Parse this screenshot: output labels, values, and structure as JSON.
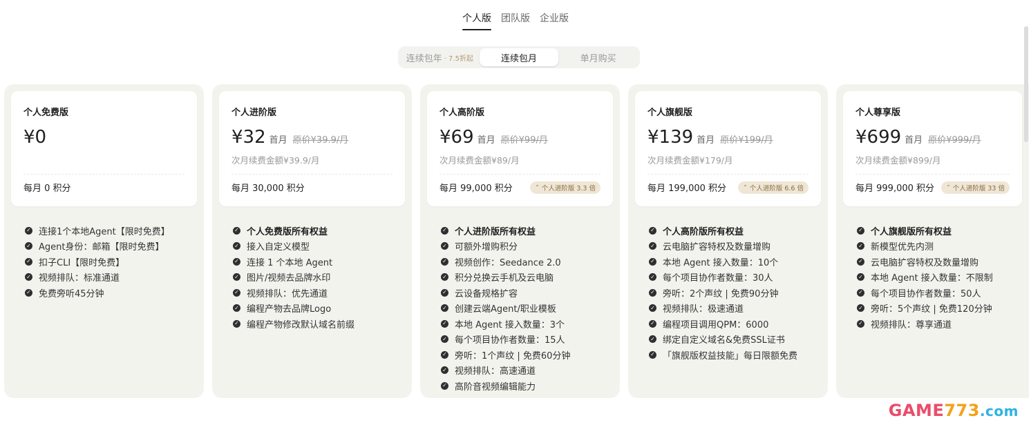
{
  "tabs": [
    "个人版",
    "团队版",
    "企业版"
  ],
  "billing": {
    "annual_label": "连续包年",
    "annual_sub": "· 7.5折起",
    "monthly_label": "连续包月",
    "single_label": "单月购买"
  },
  "plans": [
    {
      "name": "个人免费版",
      "price": "¥0",
      "first_label": "",
      "original": "",
      "renew": "",
      "credits": "每月 0 积分",
      "badge": "",
      "features": [
        {
          "text": "连接1个本地Agent【限时免费】",
          "bold": false
        },
        {
          "text": "Agent身份：邮箱【限时免费】",
          "bold": false
        },
        {
          "text": "扣子CLI【限时免费】",
          "bold": false
        },
        {
          "text": "视频排队：标准通道",
          "bold": false
        },
        {
          "text": "免费旁听45分钟",
          "bold": false
        }
      ]
    },
    {
      "name": "个人进阶版",
      "price": "¥32",
      "first_label": "首月",
      "original": "原价¥39.9/月",
      "renew": "次月续费金额¥39.9/月",
      "credits": "每月 30,000 积分",
      "badge": "",
      "features": [
        {
          "text": "个人免费版所有权益",
          "bold": true
        },
        {
          "text": "接入自定义模型",
          "bold": false
        },
        {
          "text": "连接 1 个本地 Agent",
          "bold": false
        },
        {
          "text": "图片/视频去品牌水印",
          "bold": false
        },
        {
          "text": "视频排队：优先通道",
          "bold": false
        },
        {
          "text": "编程产物去品牌Logo",
          "bold": false
        },
        {
          "text": "编程产物修改默认域名前缀",
          "bold": false
        }
      ]
    },
    {
      "name": "个人高阶版",
      "price": "¥69",
      "first_label": "首月",
      "original": "原价¥99/月",
      "renew": "次月续费金额¥89/月",
      "credits": "每月 99,000 积分",
      "badge": "个人进阶版 3.3 倍",
      "features": [
        {
          "text": "个人进阶版所有权益",
          "bold": true
        },
        {
          "text": "可额外增购积分",
          "bold": false
        },
        {
          "text": "视频创作：Seedance 2.0",
          "bold": false
        },
        {
          "text": "积分兑换云手机及云电脑",
          "bold": false
        },
        {
          "text": "云设备规格扩容",
          "bold": false
        },
        {
          "text": "创建云端Agent/职业模板",
          "bold": false
        },
        {
          "text": "本地 Agent 接入数量：3个",
          "bold": false
        },
        {
          "text": "每个项目协作者数量：15人",
          "bold": false
        },
        {
          "text": "旁听：1个声纹 | 免费60分钟",
          "bold": false
        },
        {
          "text": "视频排队：高速通道",
          "bold": false
        },
        {
          "text": "高阶音视频编辑能力",
          "bold": false
        }
      ]
    },
    {
      "name": "个人旗舰版",
      "price": "¥139",
      "first_label": "首月",
      "original": "原价¥199/月",
      "renew": "次月续费金额¥179/月",
      "credits": "每月 199,000 积分",
      "badge": "个人进阶版 6.6 倍",
      "features": [
        {
          "text": "个人高阶版所有权益",
          "bold": true
        },
        {
          "text": "云电脑扩容特权及数量增购",
          "bold": false
        },
        {
          "text": "本地 Agent 接入数量：10个",
          "bold": false
        },
        {
          "text": "每个项目协作者数量：30人",
          "bold": false
        },
        {
          "text": "旁听：2个声纹 | 免费90分钟",
          "bold": false
        },
        {
          "text": "视频排队：极速通道",
          "bold": false
        },
        {
          "text": "编程项目调用QPM：6000",
          "bold": false
        },
        {
          "text": "绑定自定义域名&免费SSL证书",
          "bold": false
        },
        {
          "text": "「旗舰版权益技能」每日限额免费",
          "bold": false
        }
      ]
    },
    {
      "name": "个人尊享版",
      "price": "¥699",
      "first_label": "首月",
      "original": "原价¥999/月",
      "renew": "次月续费金额¥899/月",
      "credits": "每月 999,000 积分",
      "badge": "个人进阶版 33 倍",
      "features": [
        {
          "text": "个人旗舰版所有权益",
          "bold": true
        },
        {
          "text": "新模型优先内测",
          "bold": false
        },
        {
          "text": "云电脑扩容特权及数量增购",
          "bold": false
        },
        {
          "text": "本地 Agent 接入数量：不限制",
          "bold": false
        },
        {
          "text": "每个项目协作者数量：50人",
          "bold": false
        },
        {
          "text": "旁听：5个声纹 | 免费120分钟",
          "bold": false
        },
        {
          "text": "视频排队：尊享通道",
          "bold": false
        }
      ]
    }
  ],
  "watermark": {
    "part1": "GAME",
    "part2": "773",
    "part3": ".com"
  }
}
